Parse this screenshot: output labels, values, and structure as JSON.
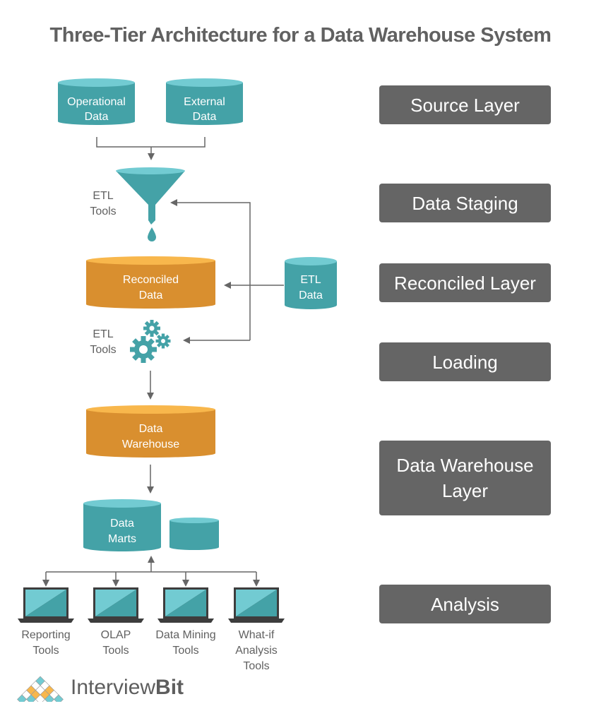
{
  "title": "Three-Tier Architecture for a Data Warehouse System",
  "colors": {
    "teal": "#44a2a7",
    "teal_top": "#72cbd2",
    "orange": "#d98f2f",
    "orange_top": "#f8b74c",
    "arrow": "#666666",
    "layer_box": "#656565",
    "text_gray": "#616161"
  },
  "nodes": {
    "operational_data": [
      "Operational",
      "Data"
    ],
    "external_data": [
      "External",
      "Data"
    ],
    "etl_tools_1": [
      "ETL",
      "Tools"
    ],
    "reconciled_data": [
      "Reconciled",
      "Data"
    ],
    "etl_data": [
      "ETL",
      "Data"
    ],
    "etl_tools_2": [
      "ETL",
      "Tools"
    ],
    "data_warehouse": [
      "Data",
      "Warehouse"
    ],
    "data_marts": [
      "Data",
      "Marts"
    ]
  },
  "tools": [
    {
      "lines": [
        "Reporting",
        "Tools"
      ]
    },
    {
      "lines": [
        "OLAP",
        "Tools"
      ]
    },
    {
      "lines": [
        "Data Mining",
        "Tools"
      ]
    },
    {
      "lines": [
        "What-if",
        "Analysis",
        "Tools"
      ]
    }
  ],
  "layers": [
    {
      "label": "Source Layer"
    },
    {
      "label": "Data Staging"
    },
    {
      "label": "Reconciled Layer"
    },
    {
      "label": "Loading"
    },
    {
      "label": "Data Warehouse Layer"
    },
    {
      "label": "Analysis"
    }
  ],
  "logo": {
    "text_regular": "Interview",
    "text_bold": "Bit"
  }
}
